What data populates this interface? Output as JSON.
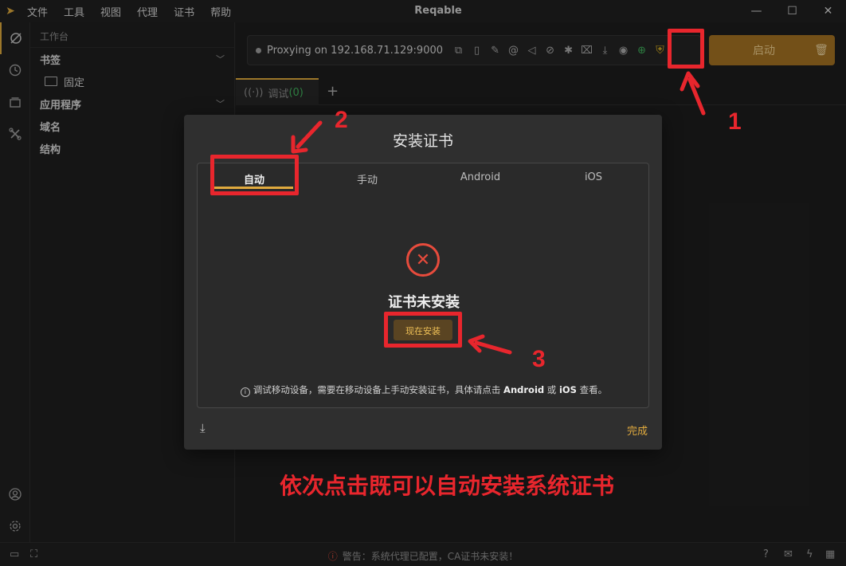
{
  "window": {
    "title": "Reqable",
    "menu": [
      "文件",
      "工具",
      "视图",
      "代理",
      "证书",
      "帮助"
    ]
  },
  "sidebar": {
    "header": "工作台",
    "items": [
      {
        "label": "书签"
      },
      {
        "label": "固定"
      },
      {
        "label": "应用程序"
      },
      {
        "label": "域名"
      },
      {
        "label": "结构"
      }
    ]
  },
  "toolbar": {
    "proxy_status": "Proxying on 192.168.71.129:9000",
    "start_label": "启动"
  },
  "tabs": {
    "debug_label": "调试",
    "debug_count": "(0)"
  },
  "dialog": {
    "title": "安装证书",
    "tabs": [
      "自动",
      "手动",
      "Android",
      "iOS"
    ],
    "status": "证书未安装",
    "install_button": "现在安装",
    "hint_prefix": "调试移动设备，需要在移动设备上手动安装证书，具体请点击",
    "hint_android": "Android",
    "hint_or": "或",
    "hint_ios": "iOS",
    "hint_suffix": "查看。",
    "done": "完成"
  },
  "annotations": {
    "step1": "1",
    "step2": "2",
    "step3": "3",
    "caption": "依次点击既可以自动安装系统证书"
  },
  "statusbar": {
    "warning": "警告：系统代理已配置，CA证书未安装！"
  },
  "colors": {
    "accent": "#d9a53b",
    "annotation_red": "#e8262d",
    "error_red": "#e74b3c",
    "running_green": "#3fae5a"
  }
}
